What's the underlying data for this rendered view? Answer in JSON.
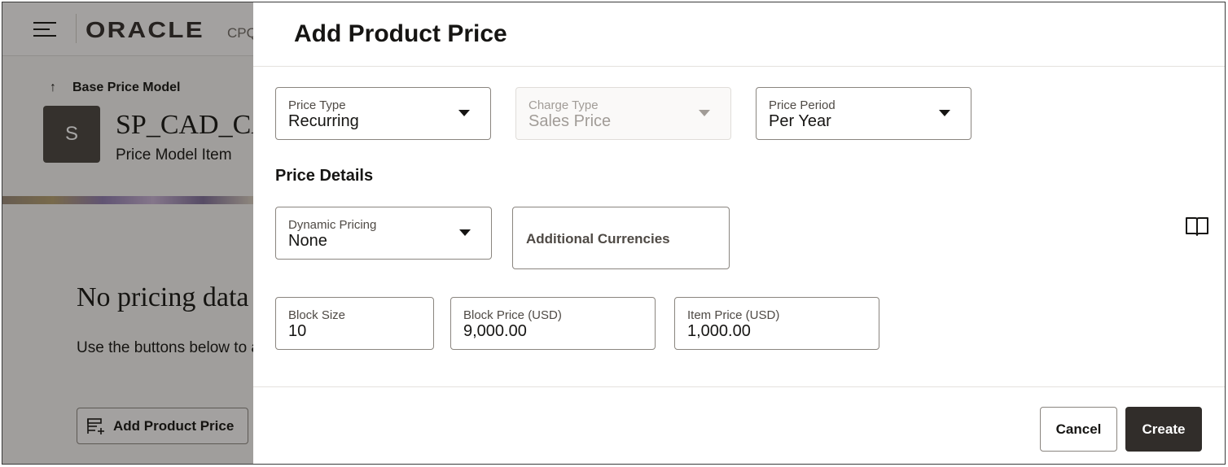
{
  "background": {
    "header": {
      "logo": "ORACLE",
      "logo_suffix": "CPQ"
    },
    "back_link": "Base Price Model",
    "avatar_letter": "S",
    "item_title": "SP_CAD_CAM_Software",
    "item_subtitle": "Price Model Item",
    "empty_title": "No pricing data yet",
    "empty_subtitle": "Use the buttons below to add prices",
    "add_button": "Add Product Price"
  },
  "drawer": {
    "title": "Add Product Price",
    "price_type": {
      "label": "Price Type",
      "value": "Recurring"
    },
    "charge_type": {
      "label": "Charge Type",
      "value": "Sales Price"
    },
    "price_period": {
      "label": "Price Period",
      "value": "Per Year"
    },
    "section_title": "Price Details",
    "dynamic_pricing": {
      "label": "Dynamic Pricing",
      "value": "None"
    },
    "additional_currencies": "Additional Currencies",
    "block_size": {
      "label": "Block Size",
      "value": "10"
    },
    "block_price": {
      "label": "Block Price (USD)",
      "value": "9,000.00"
    },
    "item_price": {
      "label": "Item Price (USD)",
      "value": "1,000.00"
    },
    "cancel": "Cancel",
    "create": "Create"
  },
  "icons": {
    "menu": "hamburger-menu-icon",
    "back": "arrow-up-icon",
    "add": "add-list-icon",
    "dropdown": "caret-down-icon",
    "help": "book-icon"
  },
  "colors": {
    "primary_button": "#312d2a",
    "border": "#8a857f",
    "disabled_text": "#a19c97"
  }
}
